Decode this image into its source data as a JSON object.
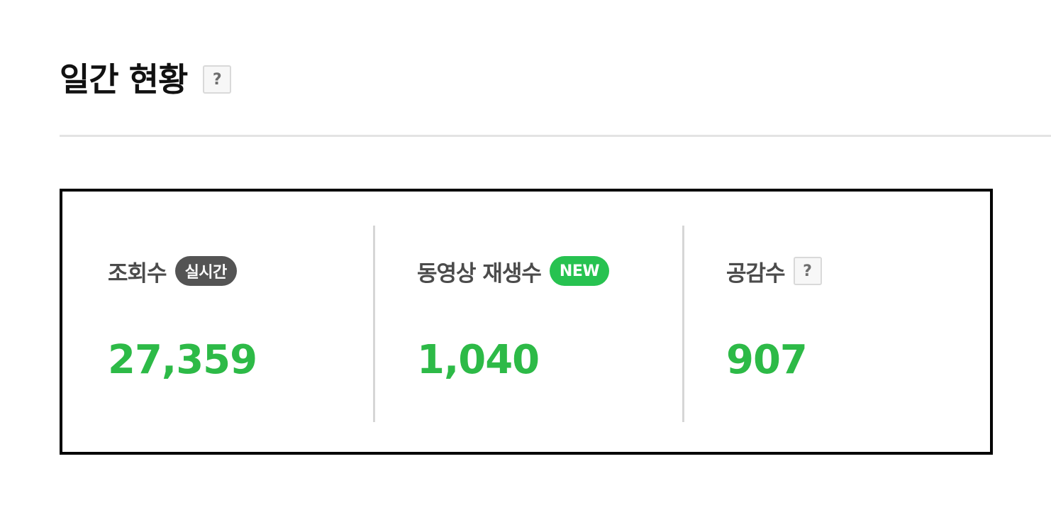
{
  "header": {
    "title": "일간 현황",
    "help_icon": "question-mark-icon",
    "help_glyph": "?"
  },
  "stats": [
    {
      "label": "조회수",
      "badge": "실시간",
      "value": "27,359"
    },
    {
      "label": "동영상 재생수",
      "badge": "NEW",
      "value": "1,040"
    },
    {
      "label": "공감수",
      "help_icon": "question-mark-icon",
      "help_glyph": "?",
      "value": "907"
    }
  ],
  "colors": {
    "accent_green": "#2dba47",
    "badge_new": "#27c250",
    "badge_realtime": "#545454",
    "label_gray": "#4b4b4b"
  }
}
